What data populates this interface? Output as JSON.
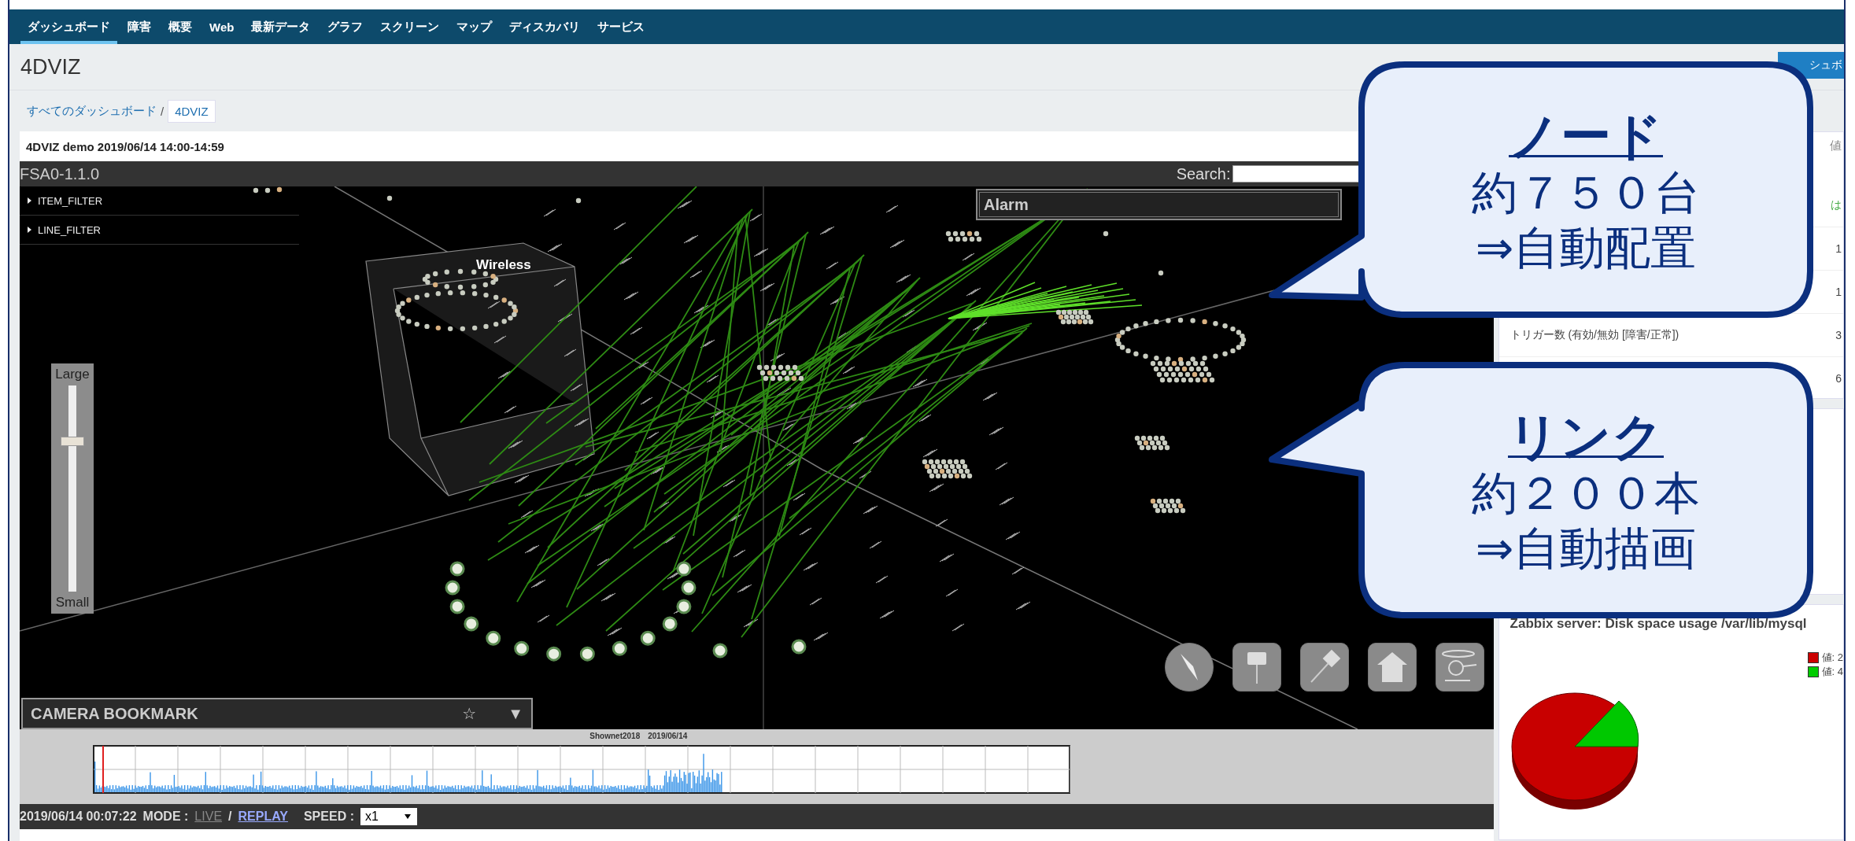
{
  "nav": {
    "items": [
      {
        "label": "ダッシュボード",
        "selected": true
      },
      {
        "label": "障害",
        "selected": false
      },
      {
        "label": "概要",
        "selected": false
      },
      {
        "label": "Web",
        "selected": false
      },
      {
        "label": "最新データ",
        "selected": false
      },
      {
        "label": "グラフ",
        "selected": false
      },
      {
        "label": "スクリーン",
        "selected": false
      },
      {
        "label": "マップ",
        "selected": false
      },
      {
        "label": "ディスカバリ",
        "selected": false
      },
      {
        "label": "サービス",
        "selected": false
      }
    ]
  },
  "header": {
    "title": "4DVIZ",
    "button": "シュボ"
  },
  "breadcrumb": [
    "すべてのダッシュボード",
    "/",
    "4DVIZ"
  ],
  "widget": {
    "title": "4DVIZ demo 2019/06/14 14:00-14:59",
    "viz": {
      "app_title": "FSA0-1.1.0",
      "search_label": "Search:",
      "filters": [
        "ITEM_FILTER",
        "LINE_FILTER"
      ],
      "alarm": "Alarm",
      "scene_label": "Wireless",
      "slider": {
        "top": "Large",
        "bottom": "Small",
        "level": 0.73
      },
      "bookmark": {
        "label": "CAMERA BOOKMARK",
        "star": "☆",
        "caret": "▼"
      },
      "timeline": {
        "title": "Shownet2018　2019/06/14"
      },
      "status": {
        "time": "2019/06/14 00:07:22",
        "mode_label": "MODE :",
        "modes": [
          {
            "label": "LIVE",
            "selected": false
          },
          {
            "label": "REPLAY",
            "selected": true
          }
        ],
        "separator": "/",
        "speed_label": "SPEED :",
        "speed": "x1"
      }
    }
  },
  "side_panel": {
    "column_header": "値",
    "rows": [
      {
        "value": "は"
      },
      {
        "value": "1"
      },
      {
        "value": "1"
      },
      {
        "label": "トリガー数 (有効/無効 [障害/正常])",
        "value": "3"
      },
      {
        "value": "6"
      }
    ],
    "pie_card": {
      "title": "Zabbix server: Disk space usage /var/lib/mysql",
      "legend": [
        {
          "label": "値: 2",
          "color": "#cc0000"
        },
        {
          "label": "値: 4",
          "color": "#00cc00"
        }
      ]
    }
  },
  "callouts": [
    {
      "title": "ノード",
      "lines": [
        "約７５０台",
        "⇒自動配置"
      ]
    },
    {
      "title": "リンク",
      "lines": [
        "約２００本",
        "⇒自動描画"
      ]
    }
  ]
}
